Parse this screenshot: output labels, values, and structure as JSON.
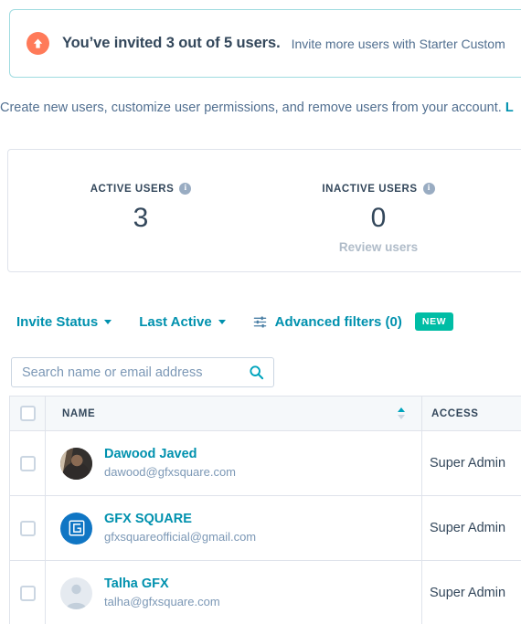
{
  "banner": {
    "icon": "arrow-up-circle-icon",
    "icon_color": "#ff7a59",
    "headline": "You’ve invited 3 out of 5 users.",
    "subtext": "Invite more users with Starter Custom",
    "border_color": "#9fdbe0"
  },
  "description": {
    "text": "Create new users, customize user permissions, and remove users from your account. ",
    "link_text": "L"
  },
  "stats": {
    "active": {
      "label": "ACTIVE USERS",
      "value": "3",
      "info_icon": "info-icon",
      "info_glyph": "i"
    },
    "inactive": {
      "label": "INACTIVE USERS",
      "value": "0",
      "info_icon": "info-icon",
      "info_glyph": "i",
      "link": "Review users"
    }
  },
  "filters": {
    "invite_status": "Invite Status",
    "last_active": "Last Active",
    "advanced": "Advanced filters (0)",
    "advanced_icon": "sliders-icon",
    "new_badge": "NEW",
    "new_badge_color": "#00bda5",
    "accent_color": "#0091ae"
  },
  "search": {
    "placeholder": "Search name or email address",
    "value": "",
    "icon": "search-icon"
  },
  "table": {
    "columns": {
      "name": "NAME",
      "access": "ACCESS"
    },
    "sort": {
      "column": "NAME",
      "direction": "asc"
    },
    "rows": [
      {
        "name": "Dawood Javed",
        "email": "dawood@gfxsquare.com",
        "access": "Super Admin",
        "avatar_type": "photo"
      },
      {
        "name": "GFX SQUARE",
        "email": "gfxsquareofficial@gmail.com",
        "access": "Super Admin",
        "avatar_type": "logo"
      },
      {
        "name": "Talha GFX",
        "email": "talha@gfxsquare.com",
        "access": "Super Admin",
        "avatar_type": "placeholder"
      }
    ]
  }
}
